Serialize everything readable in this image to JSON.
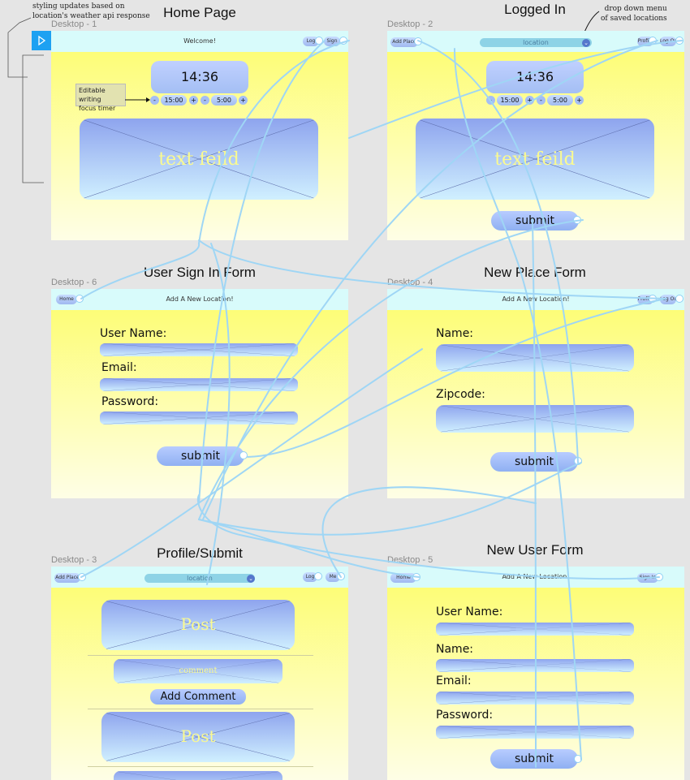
{
  "annotations": {
    "weather_note_line1": "styling updates based on",
    "weather_note_line2": "location's weather api response",
    "dropdown_note_line1": "drop down menu",
    "dropdown_note_line2": "of saved locations",
    "timer_note_line1": "Editable writing",
    "timer_note_line2": "focus timer"
  },
  "frames": {
    "home": {
      "label": "Desktop - 1",
      "title": "Home Page",
      "nav_center": "Welcome!",
      "nav_btn1": "Log",
      "nav_btn2": "Sign",
      "clock": "14:36",
      "timer1": "15:00",
      "timer2": "5:00",
      "minus": "-",
      "plus": "+",
      "text_field": "text feild"
    },
    "logged_in": {
      "label": "Desktop - 2",
      "title": "Logged In",
      "add_place": "Add Place",
      "location": "location",
      "nav_btn1": "Profile",
      "nav_btn2": "Log Out",
      "clock": "14:36",
      "timer1": "15:00",
      "timer2": "5:00",
      "minus": "-",
      "plus": "+",
      "text_field": "text feild",
      "submit": "submit"
    },
    "sign_in": {
      "label": "Desktop - 6",
      "title": "User Sign In Form",
      "home_btn": "Home",
      "nav_center": "Add A New Location!",
      "username_label": "User Name:",
      "email_label": "Email:",
      "password_label": "Password:",
      "submit": "submit"
    },
    "new_place": {
      "label": "Desktop - 4",
      "title": "New Place Form",
      "nav_center": "Add A New Location!",
      "nav_btn1": "Profile",
      "nav_btn2": "Log Out",
      "name_label": "Name:",
      "zip_label": "Zipcode:",
      "submit": "submit"
    },
    "profile": {
      "label": "Desktop - 3",
      "title": "Profile/Submit",
      "add_place": "Add Place",
      "location": "location",
      "nav_btn1": "Log",
      "nav_btn2": "Me",
      "post1": "Post",
      "comment": "comment",
      "add_comment": "Add Comment",
      "post2": "Post"
    },
    "new_user": {
      "label": "Desktop - 5",
      "title": "New User Form",
      "home_btn": "Home",
      "nav_center": "Add A New Location!",
      "nav_btn": "Sign In",
      "username_label": "User Name:",
      "name_label": "Name:",
      "email_label": "Email:",
      "password_label": "Password:",
      "submit": "submit"
    }
  },
  "colors": {
    "wire": "#9fd6f5",
    "nav_bg": "#d8fbfb",
    "page_top": "#fdfd6b",
    "play_button": "#1da1f2"
  },
  "icons": {
    "play": "play-icon",
    "dropdown": "chevron-down-icon"
  }
}
